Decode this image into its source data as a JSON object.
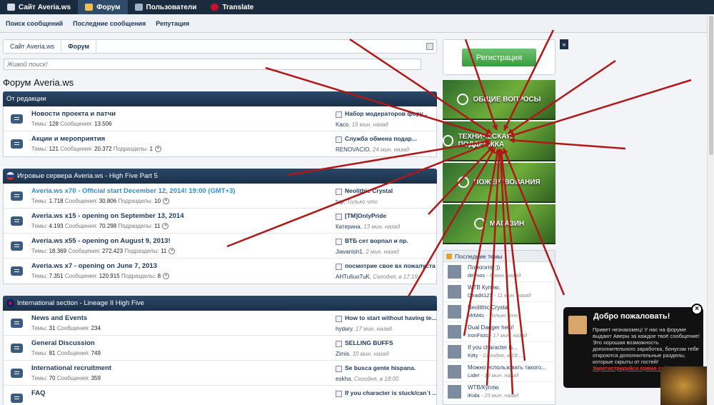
{
  "topbar": {
    "items": [
      {
        "label": "Сайт Averia.ws",
        "icon": "home-icon",
        "active": false
      },
      {
        "label": "Форум",
        "icon": "forum-icon",
        "active": true
      },
      {
        "label": "Пользователи",
        "icon": "users-icon",
        "active": false
      },
      {
        "label": "Translate",
        "icon": "uk-flag-icon",
        "active": false
      }
    ]
  },
  "subnav": {
    "items": [
      "Поиск сообщений",
      "Последние сообщения",
      "Репутация"
    ]
  },
  "breadcrumb": {
    "items": [
      "Сайт Averia.ws",
      "Форум"
    ]
  },
  "search": {
    "placeholder": "Живой поиск!"
  },
  "page_title": "Форум Averia.ws",
  "categories": [
    {
      "title": "От редакции",
      "flag": "",
      "forums": [
        {
          "name": "Новости проекта и патчи",
          "threads_label": "Темы:",
          "threads": "128",
          "posts_label": "Сообщения:",
          "posts": "13.506",
          "sub_label": "",
          "sub": "",
          "last_title": "Набор модераторов фору...",
          "last_user": "Kaco",
          "last_time": "15 мин. назад"
        },
        {
          "name": "Акции и мероприятия",
          "threads_label": "Темы:",
          "threads": "121",
          "posts_label": "Сообщения:",
          "posts": "20.372",
          "sub_label": "Подразделы:",
          "sub": "1",
          "last_title": "Служба обмена подар...",
          "last_user": "RENOVACIO",
          "last_time": "24 мин. назад"
        }
      ]
    },
    {
      "title": "Игровые сервера Averia.ws - High Five Part 5",
      "flag": "ru",
      "forums": [
        {
          "name": "Averia.ws x70 - Official start December 12, 2014! 19:00 (GMT+3)",
          "light": true,
          "threads_label": "Темы:",
          "threads": "1.718",
          "posts_label": "Сообщения:",
          "posts": "30.806",
          "sub_label": "Подразделы:",
          "sub": "10",
          "last_title": "Neolithic Crystal",
          "last_user": "tup",
          "last_time": "Только что"
        },
        {
          "name": "Averia.ws x15 - opening on September 13, 2014",
          "threads_label": "Темы:",
          "threads": "4.193",
          "posts_label": "Сообщения:",
          "posts": "70.298",
          "sub_label": "Подразделы:",
          "sub": "11",
          "last_title": "[TM]OnlyPride",
          "last_user": "Катерина",
          "last_time": "13 мин. назад"
        },
        {
          "name": "Averia.ws x55 - opening on August 9, 2013!",
          "threads_label": "Темы:",
          "threads": "18.369",
          "posts_label": "Сообщения:",
          "posts": "272.423",
          "sub_label": "Подразделы:",
          "sub": "11",
          "last_title": "ВТБ сет ворпал и пр.",
          "last_user": "Jiavanish1",
          "last_time": "2 мин. назад"
        },
        {
          "name": "Averia.ws x7 - opening on June 7, 2013",
          "threads_label": "Темы:",
          "threads": "7.351",
          "posts_label": "Сообщения:",
          "posts": "120.915",
          "sub_label": "Подразделы:",
          "sub": "8",
          "last_title": "посмотрие свое вх пожалуста",
          "last_user": "AHTu6uoTuK",
          "last_time": "Сегодня, в 17:19"
        }
      ]
    },
    {
      "title": "International section - Lineage II High Five",
      "flag": "uk",
      "forums": [
        {
          "name": "News and Events",
          "threads_label": "Темы:",
          "threads": "31",
          "posts_label": "Сообщения:",
          "posts": "234",
          "sub_label": "",
          "sub": "",
          "last_title": "How to start without having te...",
          "last_user": "hydary",
          "last_time": "17 мин. назад"
        },
        {
          "name": "General Discussion",
          "threads_label": "Темы:",
          "threads": "81",
          "posts_label": "Сообщения:",
          "posts": "749",
          "sub_label": "",
          "sub": "",
          "last_title": "SELLING BUFFS",
          "last_user": "Zimis",
          "last_time": "10 мин. назад"
        },
        {
          "name": "International recruitment",
          "threads_label": "Темы:",
          "threads": "70",
          "posts_label": "Сообщения:",
          "posts": "359",
          "sub_label": "",
          "sub": "",
          "last_title": "Se busca gente hispana.",
          "last_user": "eskha",
          "last_time": "Сегодня, в 18:00"
        },
        {
          "name": "FAQ",
          "threads_label": "",
          "threads": "",
          "posts_label": "",
          "posts": "",
          "sub_label": "",
          "sub": "",
          "last_title": "If you character is stuck/can`t ...",
          "last_user": "",
          "last_time": ""
        }
      ]
    }
  ],
  "sidebar": {
    "register_label": "Регистрация",
    "banners": [
      {
        "label": "ОБЩИЕ ВОПРОСЫ",
        "icon": "question-icon"
      },
      {
        "label": "ТЕХНИЧЕСКАЯ ПОДДЕРЖКА",
        "icon": "headset-icon"
      },
      {
        "label": "ПОЖЕРТВОВАНИЯ",
        "icon": "coins-icon"
      },
      {
        "label": "МАГАЗИН",
        "icon": "cart-icon"
      }
    ],
    "last_threads_title": "Последние темы",
    "last_threads": [
      {
        "title": "Помогите :))",
        "user": "deimos",
        "time": "6 мин. назад"
      },
      {
        "title": "WTB Куплю.",
        "user": "DeadIt123",
        "time": "11 мин. назад"
      },
      {
        "title": "Neolithic Crystal",
        "user": "MrM4s",
        "time": "Только что"
      },
      {
        "title": "Dual Dagger help!",
        "user": "IronFists",
        "time": "17 мин. назад"
      },
      {
        "title": "If you character is...",
        "user": "Kitty",
        "time": "Сегодня, в 18:..."
      },
      {
        "title": "Можно использовать такого...",
        "user": "Lider",
        "time": "19 мин. назад"
      },
      {
        "title": "WTB/Куплю",
        "user": "iKida",
        "time": "23 мин. назад"
      }
    ]
  },
  "welcome": {
    "title": "Добро пожаловать!",
    "text": "Привет незнакомец! У нас на форуме выдают Аверы за каждое твоё сообщение! Это хорошая возможность дополнительного заработка, бонусом тебе откроются дополнительные разделы, которые скрыты от гостей!",
    "link": "Зарегистрируйся прямо сейчас!"
  },
  "colors": {
    "accent": "#1b3048",
    "arrow": "#b01818",
    "link": "#1d3a5c",
    "register": "#4aa84c"
  }
}
